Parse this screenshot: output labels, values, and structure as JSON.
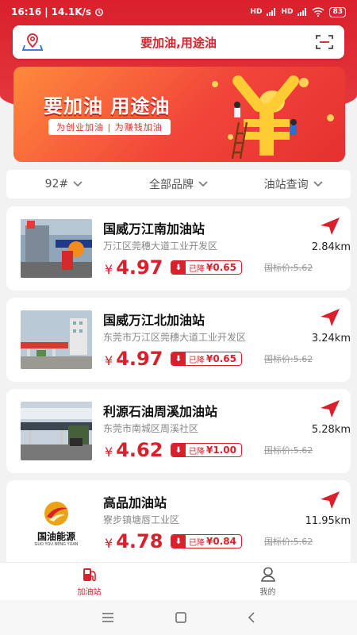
{
  "status_bar": {
    "time": "16:16",
    "speed": "14.1K/s",
    "signal_1": "HD",
    "signal_2": "HD",
    "battery": "83"
  },
  "header": {
    "title": "要加油,用途油"
  },
  "banner": {
    "headline": "要加油 用途油",
    "tagline": "为创业加油 | 为赚钱加油"
  },
  "filters": [
    {
      "label": "92#"
    },
    {
      "label": "全部品牌"
    },
    {
      "label": "油站查询"
    }
  ],
  "stations": [
    {
      "name": "国威万江南加油站",
      "address": "万江区莞穗大道工业开发区",
      "currency": "¥",
      "price": "4.97",
      "drop_label": "已降",
      "drop_amount": "¥0.65",
      "guide_price": "国标价:5.62",
      "distance": "2.84km"
    },
    {
      "name": "国威万江北加油站",
      "address": "东莞市万江区莞穗大道工业开发区",
      "currency": "¥",
      "price": "4.97",
      "drop_label": "已降",
      "drop_amount": "¥0.65",
      "guide_price": "国标价:5.62",
      "distance": "3.24km"
    },
    {
      "name": "利源石油周溪加油站",
      "address": "东莞市南城区周溪社区",
      "currency": "¥",
      "price": "4.62",
      "drop_label": "已降",
      "drop_amount": "¥1.00",
      "guide_price": "国标价:5.62",
      "distance": "5.28km"
    },
    {
      "name": "高品加油站",
      "address": "寮步镇塘唇工业区",
      "currency": "¥",
      "price": "4.78",
      "drop_label": "已降",
      "drop_amount": "¥0.84",
      "guide_price": "国标价:5.62",
      "distance": "11.95km",
      "logo_text": "国油能源",
      "logo_subtext": "GUO YOU NENG YUAN"
    }
  ],
  "tabbar": {
    "tabs": [
      {
        "label": "加油站",
        "active": true
      },
      {
        "label": "我的",
        "active": false
      }
    ]
  },
  "colors": {
    "brand_red": "#d9202c",
    "banner_orange": "#ff8a3c"
  }
}
